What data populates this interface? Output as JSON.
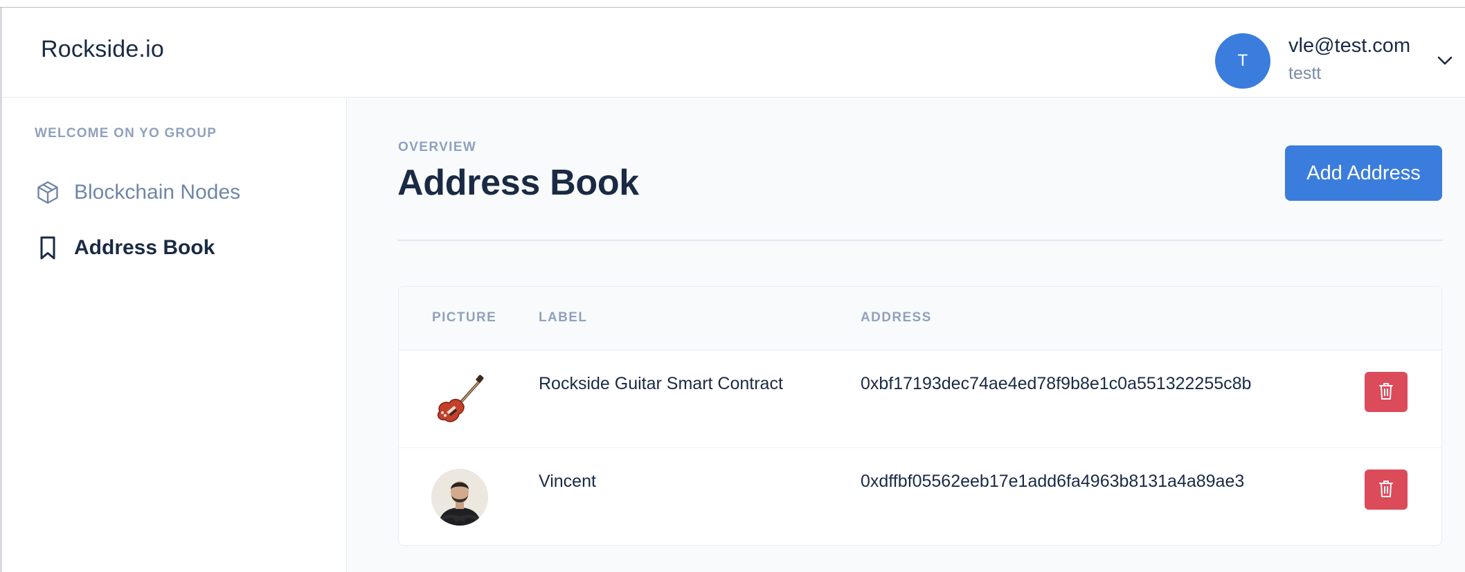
{
  "header": {
    "brand": "Rockside.io",
    "user": {
      "avatar_initial": "T",
      "email": "vle@test.com",
      "name": "testt"
    }
  },
  "sidebar": {
    "heading": "WELCOME ON YO GROUP",
    "items": [
      {
        "label": "Blockchain Nodes",
        "icon": "cube-icon",
        "active": false
      },
      {
        "label": "Address Book",
        "icon": "bookmark-icon",
        "active": true
      }
    ]
  },
  "main": {
    "overline": "OVERVIEW",
    "title": "Address Book",
    "add_button": "Add Address",
    "table": {
      "columns": [
        "PICTURE",
        "LABEL",
        "ADDRESS"
      ],
      "rows": [
        {
          "picture": "guitar-image",
          "label": "Rockside Guitar Smart Contract",
          "address": "0xbf17193dec74ae4ed78f9b8e1c0a551322255c8b"
        },
        {
          "picture": "profile-photo",
          "label": "Vincent",
          "address": "0xdffbf05562eeb17e1add6fa4963b8131a4a89ae3"
        }
      ]
    }
  },
  "colors": {
    "accent": "#3b7ddd",
    "danger": "#dc4b5a",
    "text": "#1a2a44",
    "muted": "#8fa1bd"
  }
}
